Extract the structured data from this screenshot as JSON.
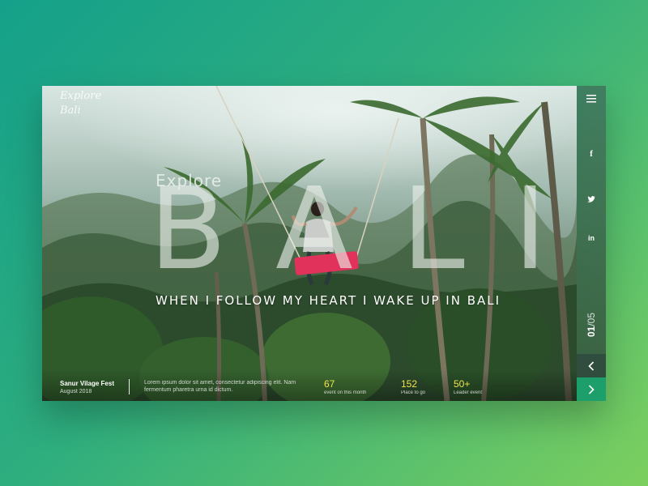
{
  "logo": {
    "line1": "Explore",
    "line2": "Bali"
  },
  "hero": {
    "explore_label": "Explore",
    "big_title": "BALI",
    "tagline": "WHEN I FOLLOW MY HEART I WAKE UP IN BALI"
  },
  "event": {
    "title": "Sanur Vilage Fest",
    "date": "August 2018"
  },
  "description": "Lorem ipsum dolor sit amet, consectetur adipiscing elit. Nam fermentum pharetra urna id dictum.",
  "stats": [
    {
      "value": "67",
      "label": "event on this month"
    },
    {
      "value": "152",
      "label": "Place to go"
    },
    {
      "value": "50+",
      "label": "Leader event"
    }
  ],
  "sidebar": {
    "menu_icon": "menu-icon",
    "social": [
      {
        "icon": "facebook-icon",
        "glyph": "f"
      },
      {
        "icon": "twitter-icon",
        "glyph": "t"
      },
      {
        "icon": "linkedin-icon",
        "glyph": "in"
      }
    ],
    "counter_current": "01",
    "counter_separator": "/",
    "counter_total": "05",
    "prev_icon": "chevron-left-icon",
    "next_icon": "chevron-right-icon"
  },
  "colors": {
    "accent": "#1d9f6c",
    "stat_value": "#f2e14c",
    "seat": "#e0325a"
  }
}
